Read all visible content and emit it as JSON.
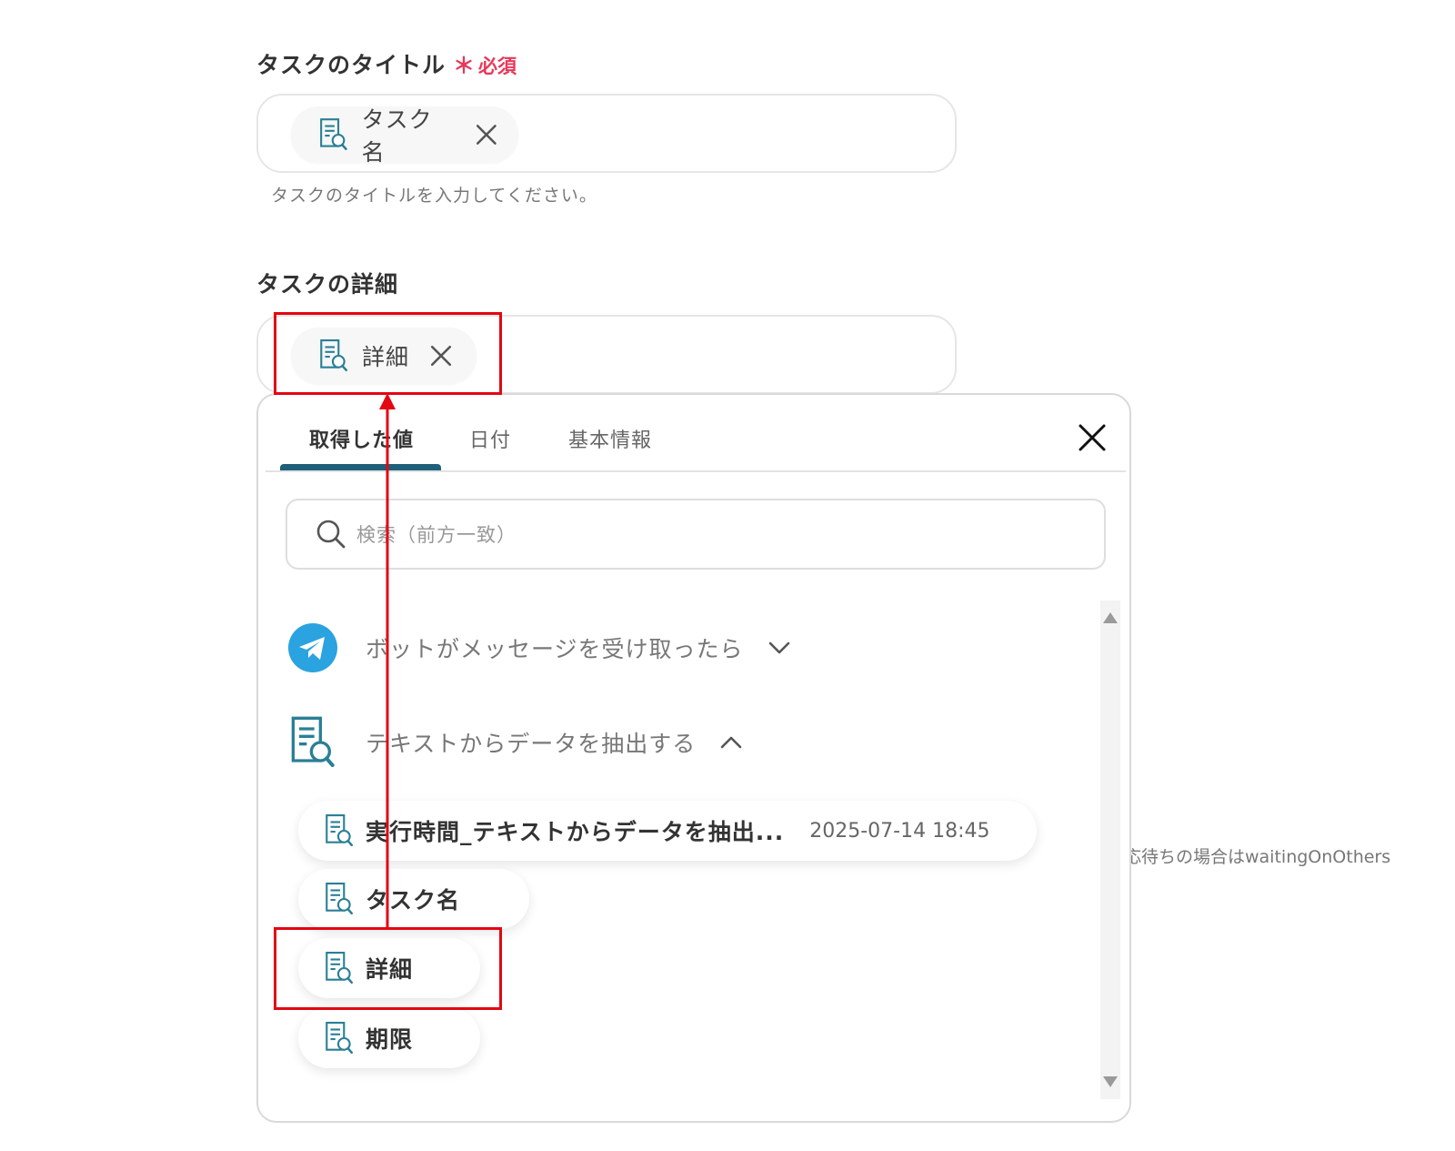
{
  "title_field": {
    "label": "タスクのタイトル",
    "required_mark": "＊",
    "required_text": "必須",
    "chip_label": "タスク名",
    "help_text": "タスクのタイトルを入力してください。"
  },
  "detail_field": {
    "label": "タスクの詳細",
    "chip_label": "詳細"
  },
  "picker": {
    "tabs": [
      {
        "label": "取得した値",
        "active": true
      },
      {
        "label": "日付",
        "active": false
      },
      {
        "label": "基本情報",
        "active": false
      }
    ],
    "search_placeholder": "検索（前方一致）",
    "groups": [
      {
        "title": "ボットがメッセージを受け取ったら",
        "expanded": false,
        "icon": "telegram-icon"
      },
      {
        "title": "テキストからデータを抽出する",
        "expanded": true,
        "icon": "document-search-icon"
      }
    ],
    "items": [
      {
        "label": "実行時間_テキストからデータを抽出...",
        "meta": "2025-07-14 18:45"
      },
      {
        "label": "タスク名",
        "meta": ""
      },
      {
        "label": "詳細",
        "meta": ""
      },
      {
        "label": "期限",
        "meta": ""
      }
    ]
  },
  "side_note": "応待ちの場合はwaitingOnOthers",
  "colors": {
    "required": "#e8375a",
    "tab_underline": "#1e5f7a",
    "icon_teal": "#2a8ea6",
    "telegram": "#2aa3e0",
    "highlight": "#e30613"
  }
}
